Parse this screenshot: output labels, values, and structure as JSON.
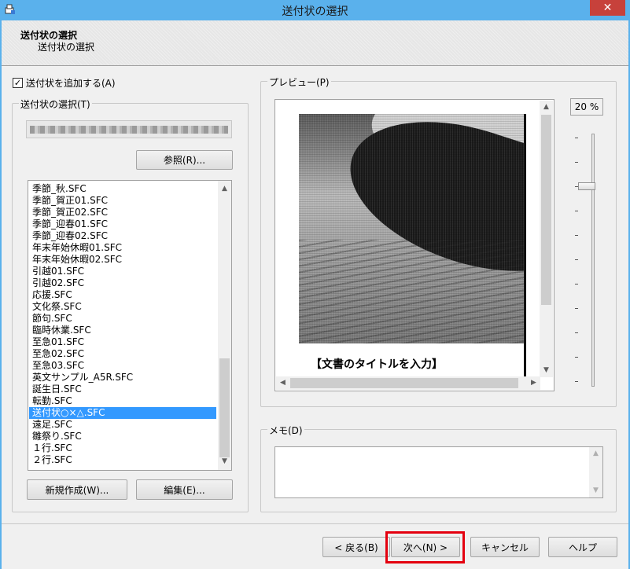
{
  "window": {
    "title": "送付状の選択",
    "close_symbol": "✕"
  },
  "header": {
    "title": "送付状の選択",
    "subtitle": "送付状の選択"
  },
  "add_cover_checkbox": {
    "label": "送付状を追加する(A)",
    "checked": true,
    "mark": "✓"
  },
  "cover_select_group": {
    "label": "送付状の選択(T)",
    "browse_button": "参照(R)...",
    "items": [
      "季節_秋.SFC",
      "季節_賀正01.SFC",
      "季節_賀正02.SFC",
      "季節_迎春01.SFC",
      "季節_迎春02.SFC",
      "年末年始休暇01.SFC",
      "年末年始休暇02.SFC",
      "引越01.SFC",
      "引越02.SFC",
      "応援.SFC",
      "文化祭.SFC",
      "節句.SFC",
      "臨時休業.SFC",
      "至急01.SFC",
      "至急02.SFC",
      "至急03.SFC",
      "英文サンプル_A5R.SFC",
      "誕生日.SFC",
      "転勤.SFC",
      "送付状○×△.SFC",
      "遠足.SFC",
      "雛祭り.SFC",
      "１行.SFC",
      "２行.SFC"
    ],
    "selected_index": 19,
    "new_button": "新規作成(W)...",
    "edit_button": "編集(E)..."
  },
  "preview_group": {
    "label": "プレビュー(P)",
    "doc_title": "【文書のタイトルを入力】",
    "zoom": "20 %",
    "zoom_level": 0.2
  },
  "memo_group": {
    "label": "メモ(D)"
  },
  "footer": {
    "back_button": "< 戻る(B)",
    "next_button": "次へ(N) >",
    "cancel_button": "キャンセル",
    "help_button": "ヘルプ"
  },
  "colors": {
    "titlebar": "#5ab1ec",
    "selection": "#3399ff",
    "highlight": "#e4000f"
  }
}
